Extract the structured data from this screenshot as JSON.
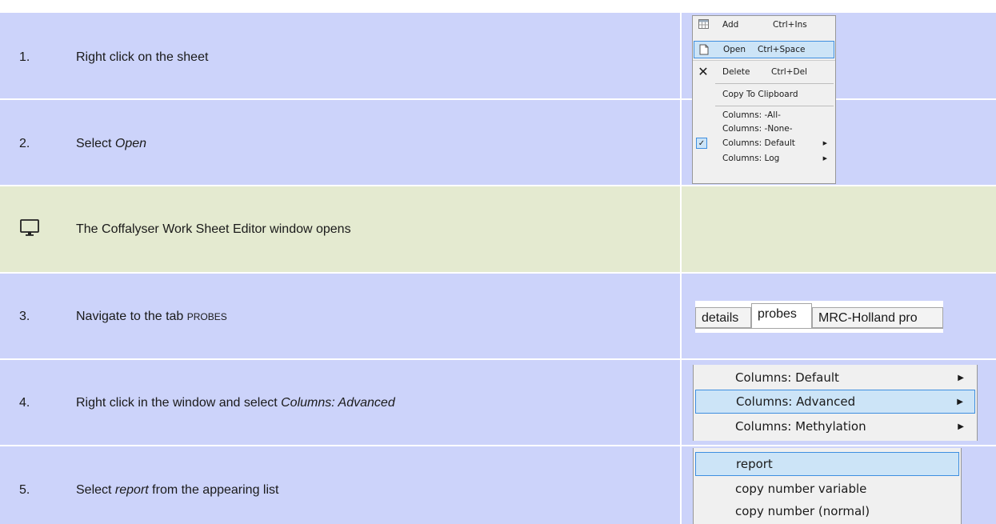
{
  "steps": [
    {
      "num": "1.",
      "text": "Right click on the sheet"
    },
    {
      "num": "2.",
      "text_pre": "Select ",
      "text_em": "Open"
    },
    {
      "text": "The Coffalyser Work Sheet Editor window opens",
      "icon": "monitor-icon"
    },
    {
      "num": "3.",
      "text_pre": "Navigate to the tab ",
      "text_sc": "PROBES"
    },
    {
      "num": "4.",
      "text_pre": "Right click in the window and select ",
      "text_em": "Columns: Advanced"
    },
    {
      "num": "5.",
      "text_pre": "Select ",
      "text_em": "report",
      "text_post": " from the appearing list"
    }
  ],
  "context_menu": [
    {
      "label": "Add",
      "shortcut": "Ctrl+Ins",
      "icon": "table-icon"
    },
    {
      "label": "Open",
      "shortcut": "Ctrl+Space",
      "icon": "document-icon",
      "highlighted": true
    },
    {
      "label": "Delete",
      "shortcut": "Ctrl+Del",
      "icon": "close-icon"
    },
    {
      "label": "Copy To Clipboard"
    },
    {
      "label": "Columns: -All-"
    },
    {
      "label": "Columns: -None-"
    },
    {
      "label": "Columns: Default",
      "checked": true,
      "submenu": true
    },
    {
      "label": "Columns: Log",
      "submenu": true
    }
  ],
  "tabs": [
    {
      "label": "details"
    },
    {
      "label": "probes",
      "selected": true
    },
    {
      "label": "MRC-Holland pro"
    }
  ],
  "columns_menu": [
    {
      "label": "Columns: Default"
    },
    {
      "label": "Columns: Advanced",
      "highlighted": true
    },
    {
      "label": "Columns: Methylation"
    }
  ],
  "report_list": [
    {
      "label": "report",
      "highlighted": true
    },
    {
      "label": "copy number variable"
    },
    {
      "label": "copy number (normal)"
    }
  ],
  "colors": {
    "blue_row": "#ccd3fa",
    "green_row": "#e4ead0",
    "highlight": "#cce4f7",
    "highlight_border": "#3e8ee0"
  }
}
